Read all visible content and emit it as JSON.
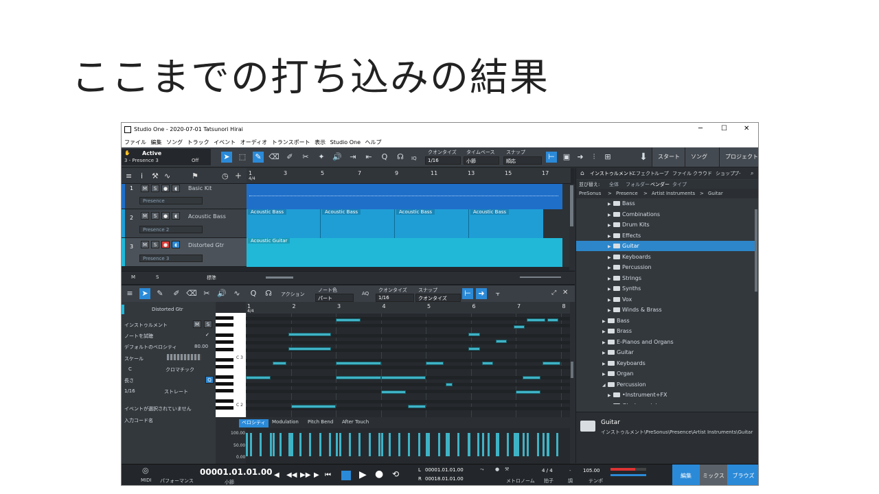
{
  "slide": {
    "title": "ここまでの打ち込みの結果"
  },
  "window": {
    "title": "Studio One - 2020-07-01 Tatsunori Hirai",
    "controls": {
      "minimize": "─",
      "maximize": "☐",
      "close": "✕"
    }
  },
  "menu": [
    "ファイル",
    "編集",
    "ソング",
    "トラック",
    "イベント",
    "オーディオ",
    "トランスポート",
    "表示",
    "Studio One",
    "ヘルプ"
  ],
  "toolbar": {
    "active_label": "Active",
    "preset": "3 - Presence 3",
    "off": "Off",
    "quantize_label": "クオンタイズ",
    "quantize_value": "1/16",
    "timebase_label": "タイムベース",
    "timebase_value": "小節",
    "snap_label": "スナップ",
    "snap_value": "順応",
    "iq": "IQ",
    "start": "スタート",
    "song": "ソング",
    "project": "プロジェクト"
  },
  "arrangement": {
    "ruler": [
      "1",
      "3",
      "5",
      "7",
      "9",
      "11",
      "13",
      "15",
      "17"
    ],
    "sig": "4/4",
    "tracks": [
      {
        "num": "1",
        "name": "Basic Kit",
        "instrument": "Presence",
        "color": "#1f6fc9"
      },
      {
        "num": "2",
        "name": "Acoustic Bass",
        "instrument": "Presence 2",
        "color": "#1f9ed6"
      },
      {
        "num": "3",
        "name": "Distorted Gtr",
        "instrument": "Presence 3",
        "color": "#21b8d8"
      }
    ],
    "bass_clips": [
      "Acoustic Bass",
      "Acoustic Bass",
      "Acoustic Bass",
      "Acoustic Bass"
    ],
    "gtr_clip": "Acoustic Guitar",
    "bottom_m": "M",
    "bottom_s": "S",
    "bottom_std": "標準"
  },
  "browser": {
    "tabs": [
      "インストゥルメント",
      "エフェクト",
      "ループ",
      "ファイル",
      "クラウド",
      "ショップ",
      "プ-"
    ],
    "sort_label": "並び替え:",
    "sort_options": [
      "全体",
      "フォルダー",
      "ベンダー",
      "タイプ"
    ],
    "path": [
      "PreSonus",
      ">",
      "Presence",
      ">",
      "Artist Instruments",
      ">",
      "Guitar"
    ],
    "items": [
      {
        "label": "Bass",
        "level": 1,
        "open": false
      },
      {
        "label": "Combinations",
        "level": 1,
        "open": false
      },
      {
        "label": "Drum Kits",
        "level": 1,
        "open": false
      },
      {
        "label": "Effects",
        "level": 1,
        "open": false
      },
      {
        "label": "Guitar",
        "level": 1,
        "open": false,
        "selected": true
      },
      {
        "label": "Keyboards",
        "level": 1,
        "open": false
      },
      {
        "label": "Percussion",
        "level": 1,
        "open": false
      },
      {
        "label": "Strings",
        "level": 1,
        "open": false
      },
      {
        "label": "Synths",
        "level": 1,
        "open": false
      },
      {
        "label": "Vox",
        "level": 1,
        "open": false
      },
      {
        "label": "Winds & Brass",
        "level": 1,
        "open": false
      },
      {
        "label": "Bass",
        "level": 0,
        "open": false
      },
      {
        "label": "Brass",
        "level": 0,
        "open": false
      },
      {
        "label": "E-Pianos and Organs",
        "level": 0,
        "open": false
      },
      {
        "label": "Guitar",
        "level": 0,
        "open": false
      },
      {
        "label": "Keyboards",
        "level": 0,
        "open": false
      },
      {
        "label": "Organ",
        "level": 0,
        "open": false
      },
      {
        "label": "Percussion",
        "level": 0,
        "open": true
      },
      {
        "label": "•Instrument+FX",
        "level": 1,
        "open": false
      },
      {
        "label": "Glockenspiel",
        "level": 1,
        "open": false
      }
    ],
    "info_title": "Guitar",
    "info_path": "インストゥルメント\\PreSonus\\Presence\\Artist Instruments\\Guitar"
  },
  "editor": {
    "action": "アクション",
    "note_color_label": "ノート色",
    "note_color_value": "パート",
    "aq": "AQ",
    "quantize_label": "クオンタイズ",
    "quantize_value": "1/16",
    "snap_label": "スナップ",
    "snap_value": "クオンタイズ",
    "ruler": [
      "1",
      "2",
      "3",
      "4",
      "5",
      "6",
      "7",
      "8"
    ],
    "sig": "4/4",
    "inspector": {
      "track": "Distorted Gtr",
      "instrument": "インストゥルメント",
      "m": "M",
      "s": "S",
      "audition": "ノートを試聴",
      "check": "✓",
      "velocity_label": "デフォルトのベロシティ",
      "velocity_value": "80.00",
      "scale": "スケール",
      "key": "C",
      "chromatic": "クロマチック",
      "length": "長さ",
      "q": "Q",
      "len_value": "1/16",
      "straight": "ストレート",
      "no_event": "イベントが選択されていません",
      "chord_input": "入力コード名"
    },
    "piano_labels": [
      "C 3",
      "C 2"
    ],
    "vel_tabs": [
      "ベロシティ",
      "Modulation",
      "Pitch Bend",
      "After Touch"
    ],
    "vel_scale": [
      "100.00",
      "50.00",
      "0.00"
    ]
  },
  "transport": {
    "midi": "MIDI",
    "perf": "パフォーマンス",
    "time": "00001.01.01.00",
    "time_unit": "小節",
    "loop_l": "L",
    "loop_l_val": "00001.01.01.00",
    "loop_r": "R",
    "loop_r_val": "00018.01.01.00",
    "metronome": "メトロノーム",
    "sig": "4 / 4",
    "sig_label": "拍子",
    "key_label": "調",
    "key_val": "-",
    "tempo": "105.00",
    "tempo_label": "テンポ",
    "edit": "編集",
    "mix": "ミックス",
    "browse": "ブラウズ"
  },
  "notes": [
    {
      "bar": 1.0,
      "dur": 0.55,
      "pitch": 5
    },
    {
      "bar": 1.6,
      "dur": 0.3,
      "pitch": 7
    },
    {
      "bar": 1.95,
      "dur": 0.95,
      "pitch": 9
    },
    {
      "bar": 1.95,
      "dur": 0.95,
      "pitch": 11
    },
    {
      "bar": 3.0,
      "dur": 0.55,
      "pitch": 13
    },
    {
      "bar": 3.0,
      "dur": 1.0,
      "pitch": 7
    },
    {
      "bar": 3.0,
      "dur": 1.0,
      "pitch": 5
    },
    {
      "bar": 2.0,
      "dur": 1.0,
      "pitch": 1
    },
    {
      "bar": 4.0,
      "dur": 0.55,
      "pitch": 3
    },
    {
      "bar": 4.0,
      "dur": 1.0,
      "pitch": 5
    },
    {
      "bar": 4.6,
      "dur": 0.4,
      "pitch": 1
    },
    {
      "bar": 5.0,
      "dur": 0.4,
      "pitch": 7
    },
    {
      "bar": 5.45,
      "dur": 0.15,
      "pitch": 4
    },
    {
      "bar": 5.95,
      "dur": 0.25,
      "pitch": 9
    },
    {
      "bar": 5.95,
      "dur": 0.25,
      "pitch": 11
    },
    {
      "bar": 6.25,
      "dur": 0.25,
      "pitch": 7
    },
    {
      "bar": 6.55,
      "dur": 0.25,
      "pitch": 10
    },
    {
      "bar": 6.95,
      "dur": 0.25,
      "pitch": 12
    },
    {
      "bar": 7.25,
      "dur": 0.4,
      "pitch": 13
    },
    {
      "bar": 7.7,
      "dur": 0.25,
      "pitch": 13
    },
    {
      "bar": 7.6,
      "dur": 0.4,
      "pitch": 7
    },
    {
      "bar": 7.15,
      "dur": 0.4,
      "pitch": 5
    },
    {
      "bar": 7.0,
      "dur": 0.55,
      "pitch": 3
    }
  ]
}
